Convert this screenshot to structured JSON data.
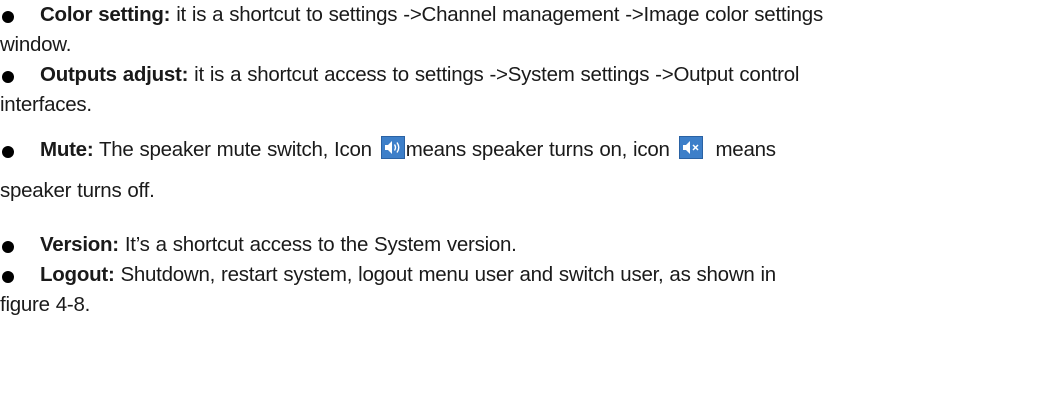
{
  "items": [
    {
      "term": "Color setting:",
      "line1": " it is a shortcut to settings ->Channel management ->Image color settings",
      "line2": "window."
    },
    {
      "term": "Outputs adjust:",
      "line1": " it is a shortcut access to settings ->System settings ->Output control",
      "line2": "interfaces."
    },
    {
      "term": "Mute:",
      "line1a": " The speaker mute switch, Icon ",
      "icon_on": "speaker-on-icon",
      "line1b": "means speaker turns on, icon ",
      "icon_off": "speaker-off-icon",
      "line1c": "  means",
      "line2": "speaker turns off."
    },
    {
      "term": "Version:",
      "line1": " It’s a shortcut access to the System version."
    },
    {
      "term": "Logout:",
      "line1": " Shutdown, restart system, logout menu user and switch user, as shown in",
      "line2": "figure 4-8."
    }
  ],
  "colors": {
    "icon_background": "#3d7fc9",
    "text": "#1a1a1a"
  }
}
